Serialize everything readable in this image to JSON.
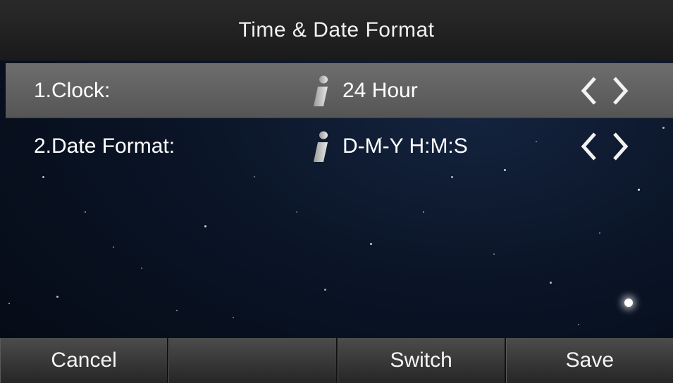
{
  "screen": {
    "title": "Time & Date Format"
  },
  "settings": [
    {
      "label": "1.Clock:",
      "value": "24 Hour",
      "selected": true
    },
    {
      "label": "2.Date Format:",
      "value": "D-M-Y H:M:S",
      "selected": false
    }
  ],
  "softkeys": [
    {
      "label": "Cancel"
    },
    {
      "label": ""
    },
    {
      "label": "Switch"
    },
    {
      "label": "Save"
    }
  ],
  "icons": {
    "info": "info-icon",
    "left": "chevron-left-icon",
    "right": "chevron-right-icon"
  },
  "colors": {
    "selected_row": "#5f5f5f",
    "background": "#0a1426",
    "text": "#ffffff"
  }
}
